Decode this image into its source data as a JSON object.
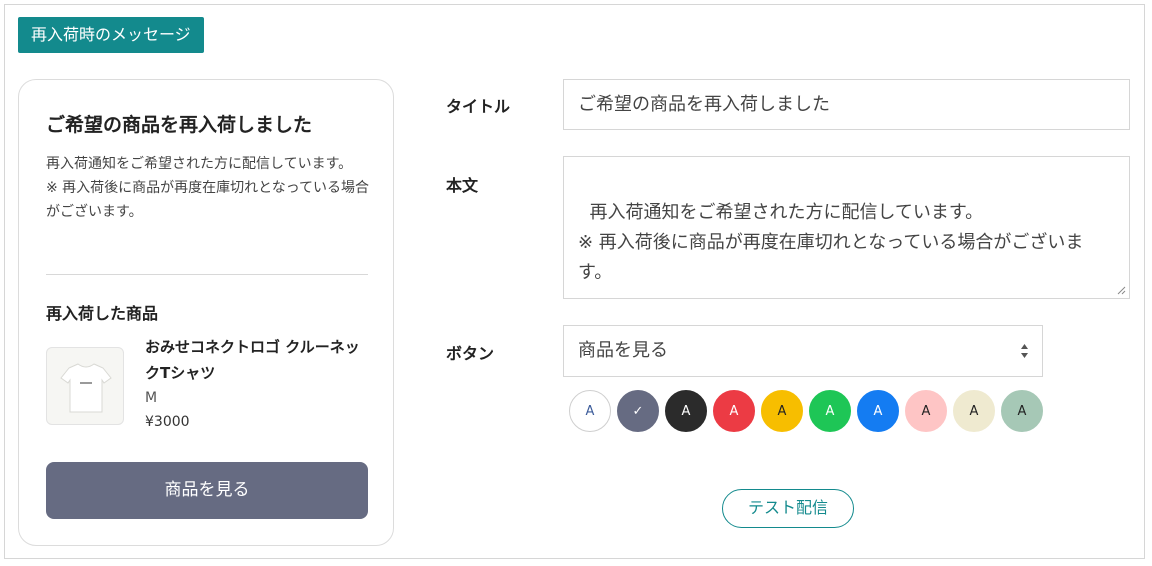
{
  "section_tag": "再入荷時のメッセージ",
  "preview": {
    "title": "ご希望の商品を再入荷しました",
    "body": "再入荷通知をご希望された方に配信しています。\n※ 再入荷後に商品が再度在庫切れとなっている場合がございます。",
    "section_label": "再入荷した商品",
    "product": {
      "name": "おみせコネクトロゴ クルーネックTシャツ",
      "variant": "M",
      "price": "¥3000",
      "thumb_icon": "tshirt-icon"
    },
    "button_label": "商品を見る"
  },
  "form": {
    "title_label": "タイトル",
    "title_value": "ご希望の商品を再入荷しました",
    "body_label": "本文",
    "body_value": "再入荷通知をご希望された方に配信しています。\n※ 再入荷後に商品が再度在庫切れとなっている場合がございます。",
    "button_label": "ボタン",
    "button_value": "商品を見る",
    "swatches": [
      {
        "bg": "#ffffff",
        "fg": "#3b5b9a",
        "text": "A",
        "border": "#cfcfcf",
        "selected": false
      },
      {
        "bg": "#666b82",
        "fg": "#ffffff",
        "text": "✓",
        "border": "#666b82",
        "selected": true
      },
      {
        "bg": "#2b2b2b",
        "fg": "#ffffff",
        "text": "A",
        "border": "#2b2b2b",
        "selected": false
      },
      {
        "bg": "#ec3b44",
        "fg": "#ffffff",
        "text": "A",
        "border": "#ec3b44",
        "selected": false
      },
      {
        "bg": "#f7be00",
        "fg": "#222222",
        "text": "A",
        "border": "#f7be00",
        "selected": false
      },
      {
        "bg": "#1ec656",
        "fg": "#ffffff",
        "text": "A",
        "border": "#1ec656",
        "selected": false
      },
      {
        "bg": "#147cf2",
        "fg": "#ffffff",
        "text": "A",
        "border": "#147cf2",
        "selected": false
      },
      {
        "bg": "#fec5c5",
        "fg": "#222222",
        "text": "A",
        "border": "#fec5c5",
        "selected": false
      },
      {
        "bg": "#efead0",
        "fg": "#222222",
        "text": "A",
        "border": "#efead0",
        "selected": false
      },
      {
        "bg": "#a6c8b6",
        "fg": "#222222",
        "text": "A",
        "border": "#a6c8b6",
        "selected": false
      }
    ]
  },
  "test_button": "テスト配信",
  "colors": {
    "accent": "#138a8d",
    "button": "#666b82"
  }
}
